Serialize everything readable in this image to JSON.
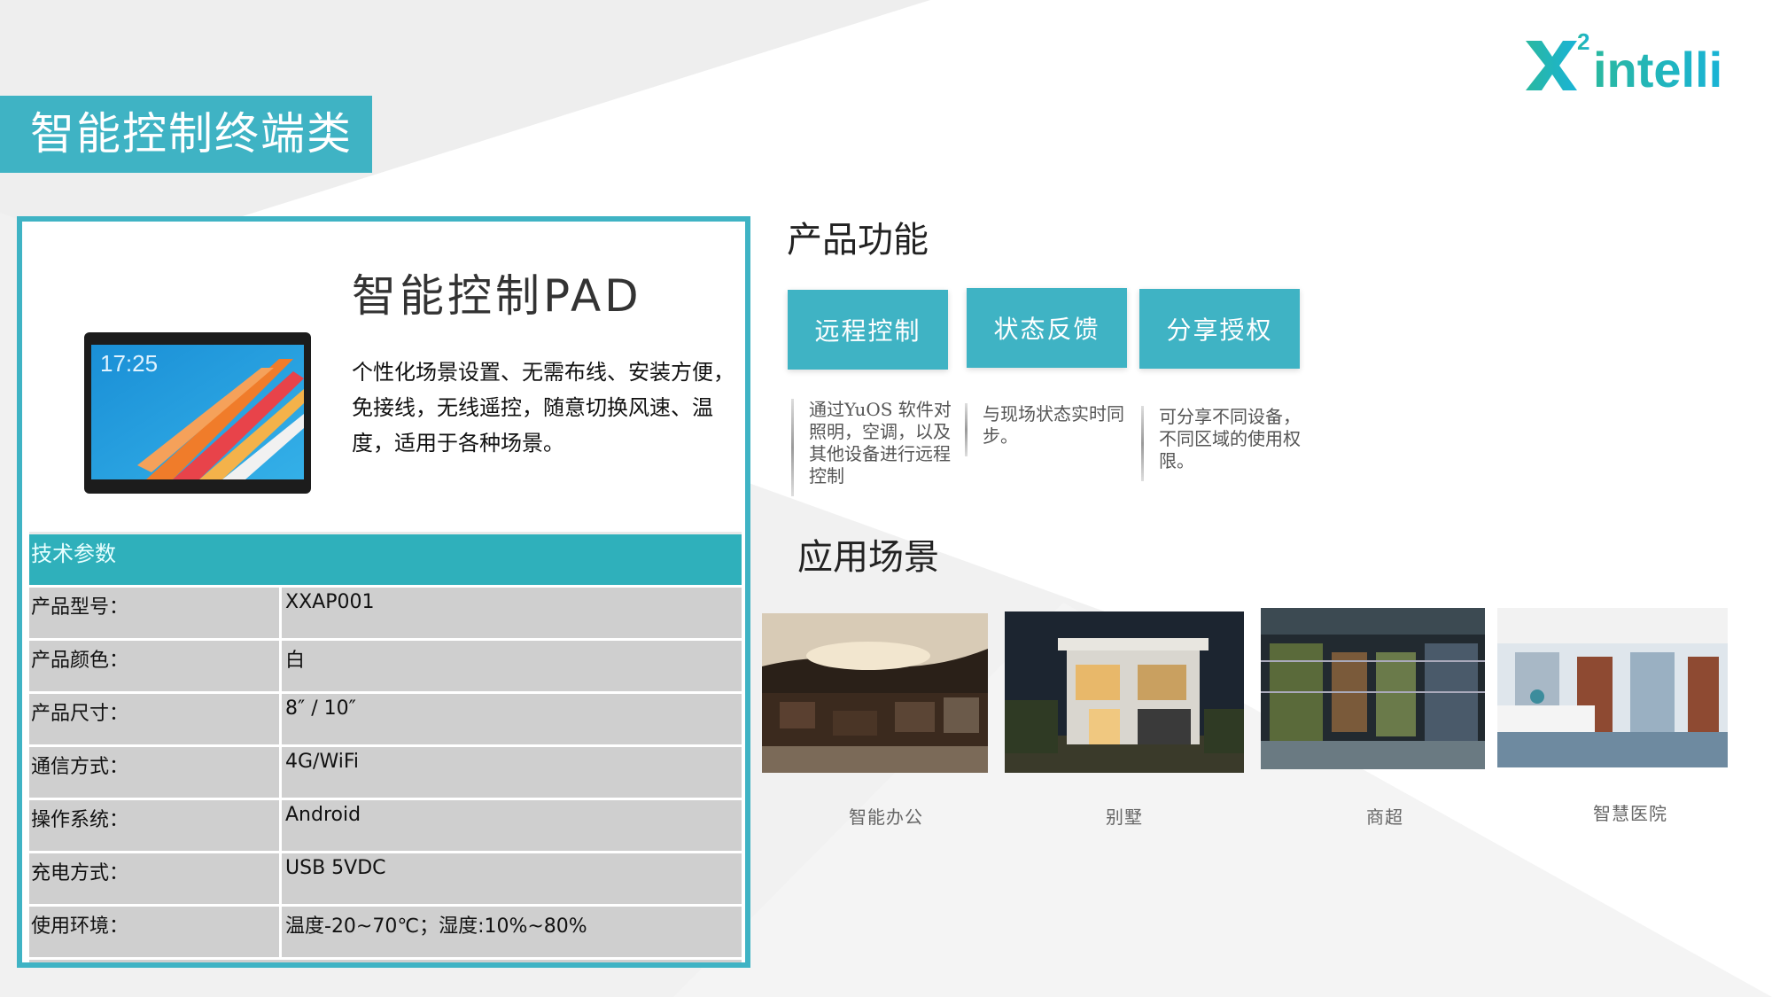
{
  "logo": {
    "text": "intelli",
    "superscript": "2"
  },
  "banner": {
    "title": "智能控制终端类"
  },
  "product": {
    "name": "智能控制PAD",
    "description": "个性化场景设置、无需布线、安装方便，免接线，无线遥控，随意切换风速、温度，适用于各种场景。",
    "screen_time": "17:25",
    "specs_title": "技术参数",
    "specs": [
      {
        "label": "产品型号：",
        "value": "XXAP001"
      },
      {
        "label": "产品颜色：",
        "value": "白"
      },
      {
        "label": "产品尺寸：",
        "value": "8″ / 10″"
      },
      {
        "label": "通信方式：",
        "value": "4G/WiFi"
      },
      {
        "label": "操作系统：",
        "value": "Android"
      },
      {
        "label": "充电方式：",
        "value": "USB 5VDC"
      },
      {
        "label": "使用环境：",
        "value": "温度-20~70℃；湿度:10%~80%"
      }
    ]
  },
  "features": {
    "title": "产品功能",
    "items": [
      {
        "label": "远程控制",
        "desc": "通过YuOS 软件对照明，空调，以及其他设备进行远程控制"
      },
      {
        "label": "状态反馈",
        "desc": "与现场状态实时同步。"
      },
      {
        "label": "分享授权",
        "desc": "可分享不同设备，不同区域的使用权限。"
      }
    ]
  },
  "scenarios": {
    "title": "应用场景",
    "items": [
      {
        "label": "智能办公"
      },
      {
        "label": "别墅"
      },
      {
        "label": "商超"
      },
      {
        "label": "智慧医院"
      }
    ]
  },
  "colors": {
    "accent": "#3fb3c4",
    "table_header": "#2fb0bb",
    "table_row": "#cfcfcf"
  }
}
